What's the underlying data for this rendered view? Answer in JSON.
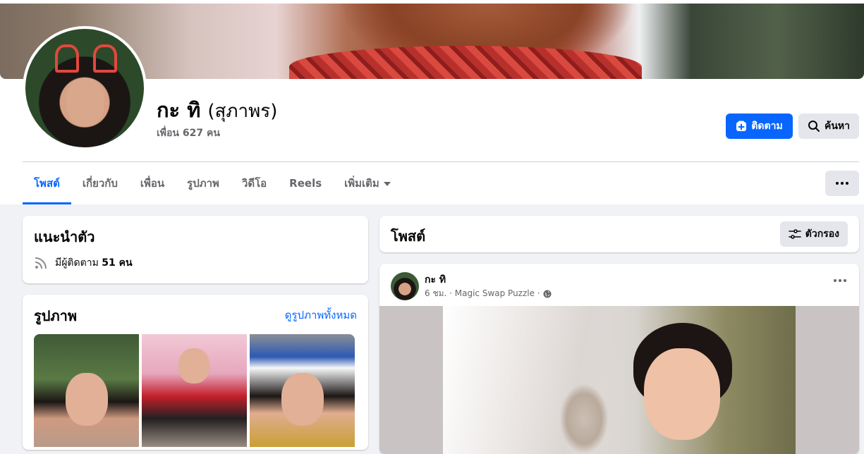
{
  "profile": {
    "name": "กะ ทิ",
    "alternate_name": "(สุภาพร)",
    "friends": "เพื่อน 627 คน"
  },
  "actions": {
    "follow_label": "ติดตาม",
    "search_label": "ค้นหา"
  },
  "tabs": [
    {
      "label": "โพสต์",
      "active": true
    },
    {
      "label": "เกี่ยวกับ"
    },
    {
      "label": "เพื่อน"
    },
    {
      "label": "รูปภาพ"
    },
    {
      "label": "วิดีโอ"
    },
    {
      "label": "Reels"
    },
    {
      "label": "เพิ่มเติม"
    }
  ],
  "intro": {
    "title": "แนะนำตัว",
    "followers_prefix": "มีผู้ติดตาม",
    "followers_count": "51 คน"
  },
  "photos": {
    "title": "รูปภาพ",
    "see_all": "ดูรูปภาพทั้งหมด"
  },
  "posts": {
    "title": "โพสต์",
    "filter_label": "ตัวกรอง"
  },
  "post": {
    "author": "กะ ทิ",
    "meta": "6 ชม. · Magic Swap Puzzle ·"
  },
  "colors": {
    "accent": "#0866ff",
    "secondary_button": "#e4e6eb",
    "background": "#f0f2f5"
  },
  "icons": {
    "follow": "follow-plus-icon",
    "search": "search-icon",
    "more": "more-dots-icon",
    "dropdown": "chevron-down-icon",
    "followers": "rss-icon",
    "filter": "filter-sliders-icon",
    "privacy": "globe-icon"
  }
}
